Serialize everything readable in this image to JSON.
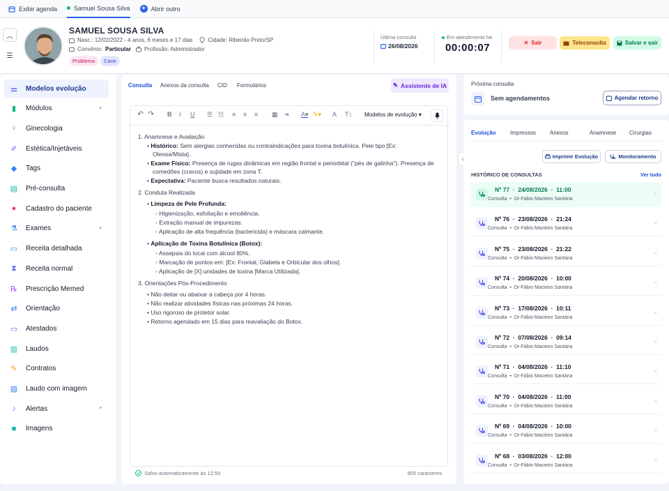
{
  "topbar": {
    "show_agenda": "Exibir agenda",
    "patient_tab": "Samuel Sousa Silva",
    "open_other": "Abrir outro"
  },
  "patient": {
    "name": "SAMUEL SOUSA SILVA",
    "birth": "Nasc.: 12/02/2022 - 4 anos, 6 meses e 17 dias",
    "city": "Cidade: Ribeirão Preto/SP",
    "insurance_label": "Convênio:",
    "insurance_value": "Particular",
    "profession": "Profissão: Administrador",
    "tags": [
      "Problema",
      "Carie"
    ]
  },
  "consult_info": {
    "last_label": "Última consulta",
    "last_date": "26/08/2026",
    "status_label": "Em atendimento há",
    "timer": "00:00:07"
  },
  "header_buttons": {
    "exit": "Sair",
    "tele": "Teleconsulta",
    "save_exit": "Salvar e sair"
  },
  "colors": {
    "accent": "#2563eb",
    "exit_bg": "#fee2e2",
    "tele_bg": "#fde68a",
    "save_bg": "#d1fae5",
    "active_row": "#ecfdf5"
  },
  "sidebar": {
    "items": [
      {
        "label": "Modelos evolução",
        "icon": "sliders-icon",
        "color": "#6366f1"
      },
      {
        "label": "Módulos",
        "icon": "chart-bars-icon",
        "color": "#10b981"
      },
      {
        "label": "Ginecologia",
        "icon": "female-icon",
        "color": "#ec4899"
      },
      {
        "label": "Estética/Injetáveis",
        "icon": "syringe-icon",
        "color": "#8b5cf6"
      },
      {
        "label": "Tags",
        "icon": "tag-icon",
        "color": "#3b82f6"
      },
      {
        "label": "Pré-consulta",
        "icon": "clipboard-icon",
        "color": "#14b8a6"
      },
      {
        "label": "Cadastro do paciente",
        "icon": "user-icon",
        "color": "#f43f5e"
      },
      {
        "label": "Exames",
        "icon": "flask-icon",
        "color": "#3b82f6"
      },
      {
        "label": "Receita detalhada",
        "icon": "document-icon",
        "color": "#3b82f6"
      },
      {
        "label": "Receita normal",
        "icon": "hourglass-icon",
        "color": "#6366f1"
      },
      {
        "label": "Prescrição Memed",
        "icon": "rx-icon",
        "color": "#a855f7"
      },
      {
        "label": "Orientação",
        "icon": "shuffle-icon",
        "color": "#3b82f6"
      },
      {
        "label": "Atestados",
        "icon": "document-icon",
        "color": "#6366f1"
      },
      {
        "label": "Laudos",
        "icon": "report-icon",
        "color": "#14b8a6"
      },
      {
        "label": "Contratos",
        "icon": "pen-icon",
        "color": "#f59e0b"
      },
      {
        "label": "Laudo com imagem",
        "icon": "image-doc-icon",
        "color": "#3b82f6"
      },
      {
        "label": "Alertas",
        "icon": "bell-icon",
        "color": "#3b82f6"
      },
      {
        "label": "Imagens",
        "icon": "camera-icon",
        "color": "#14b8a6"
      }
    ]
  },
  "center": {
    "tabs": [
      "Consulta",
      "Anexos da consulta",
      "CID",
      "Formulários"
    ],
    "ai_button": "Assistente de IA",
    "models_dropdown": "Modelos de evolução",
    "document": {
      "s1": "1. Anamnese e Avaliação",
      "hist_b": "Histórico:",
      "hist_t1": "Sem alergias conhecidas ou contraindicações para toxina botulínica. Pele tipo [Ex:",
      "hist_t2": "Oleosa/Mista].",
      "exam_b": "Exame Físico:",
      "exam_t1": "Presença de rugas dinâmicas em região frontal e periorbital (\"pés de galinha\"). Presença de",
      "exam_t2": "comedões (cravos) e sujidade em zona T.",
      "exp_b": "Expectativa:",
      "exp_t": "Paciente busca resultados naturais.",
      "s2": "2. Conduta Realizada",
      "limp_b": "Limpeza de Pele Profunda:",
      "limp_items": [
        "Higienização, esfoliação e emoliência.",
        "Extração manual de impurezas.",
        "Aplicação de alta frequência (bactericida) e máscara calmante."
      ],
      "tox_b": "Aplicação de Toxina Botulínica (Botox):",
      "tox_items": [
        "Assepsia do local com álcool 80%.",
        "Marcação de pontos em: [Ex: Frontal, Glabela e Orbicular dos olhos].",
        "Aplicação de [X] unidades de toxina [Marca Utilizada]."
      ],
      "s3": "3. Orientações Pós-Procedimento",
      "post_items": [
        "Não deitar ou abaixar a cabeça por 4 horas.",
        "Não realizar atividades físicas nas próximas 24 horas.",
        "Uso rigoroso de protetor solar.",
        "Retorno agendado em 15 dias para reavaliação do Botox."
      ]
    },
    "autosave": "Salvo automaticamente às 12:59",
    "char_count": "905 caracteres"
  },
  "next_consult": {
    "label": "Próxima consulta",
    "none": "Sem agendamentos",
    "schedule_button": "Agendar retorno"
  },
  "right": {
    "tabs": [
      "Evolução",
      "Impressos",
      "Anexos",
      "Anamnese",
      "Cirurgias"
    ],
    "print_button": "Imprimir Evolução",
    "monitor_button": "Monitoramento",
    "history_title": "HISTÓRICO DE CONSULTAS",
    "see_all": "Ver tudo",
    "history": [
      {
        "num": "Nº 77",
        "date": "24/08/2026",
        "time": "11:00",
        "sub": "Consulta",
        "doctor": "Dr-Fábio Macieiro Santána"
      },
      {
        "num": "Nº 76",
        "date": "23/08/2026",
        "time": "21:24",
        "sub": "Consulta",
        "doctor": "Dr-Fábio Macieiro Santána"
      },
      {
        "num": "Nº 75",
        "date": "23/08/2026",
        "time": "21:22",
        "sub": "Consulta",
        "doctor": "Dr-Fábio Macieiro Santána"
      },
      {
        "num": "Nº 74",
        "date": "20/08/2026",
        "time": "10:00",
        "sub": "Consulta",
        "doctor": "Dr-Fábio Macieiro Santána"
      },
      {
        "num": "Nº 73",
        "date": "17/08/2026",
        "time": "10:11",
        "sub": "Consulta",
        "doctor": "Dr-Fábio Macieiro Santána"
      },
      {
        "num": "Nº 72",
        "date": "07/08/2026",
        "time": "09:14",
        "sub": "Consulta",
        "doctor": "Dr-Fábio Macieiro Santána"
      },
      {
        "num": "Nº 71",
        "date": "04/08/2026",
        "time": "11:10",
        "sub": "Consulta",
        "doctor": "Dr-Fábio Macieiro Santána"
      },
      {
        "num": "Nº 70",
        "date": "04/08/2026",
        "time": "11:00",
        "sub": "Consulta",
        "doctor": "Dr-Fábio Macieiro Santána"
      },
      {
        "num": "Nº 69",
        "date": "04/08/2026",
        "time": "10:00",
        "sub": "Consulta",
        "doctor": "Dr-Fábio Macieiro Santána"
      },
      {
        "num": "Nº 68",
        "date": "03/08/2026",
        "time": "12:00",
        "sub": "Consulta",
        "doctor": "Dr-Fábio Macieiro Santána"
      }
    ]
  }
}
